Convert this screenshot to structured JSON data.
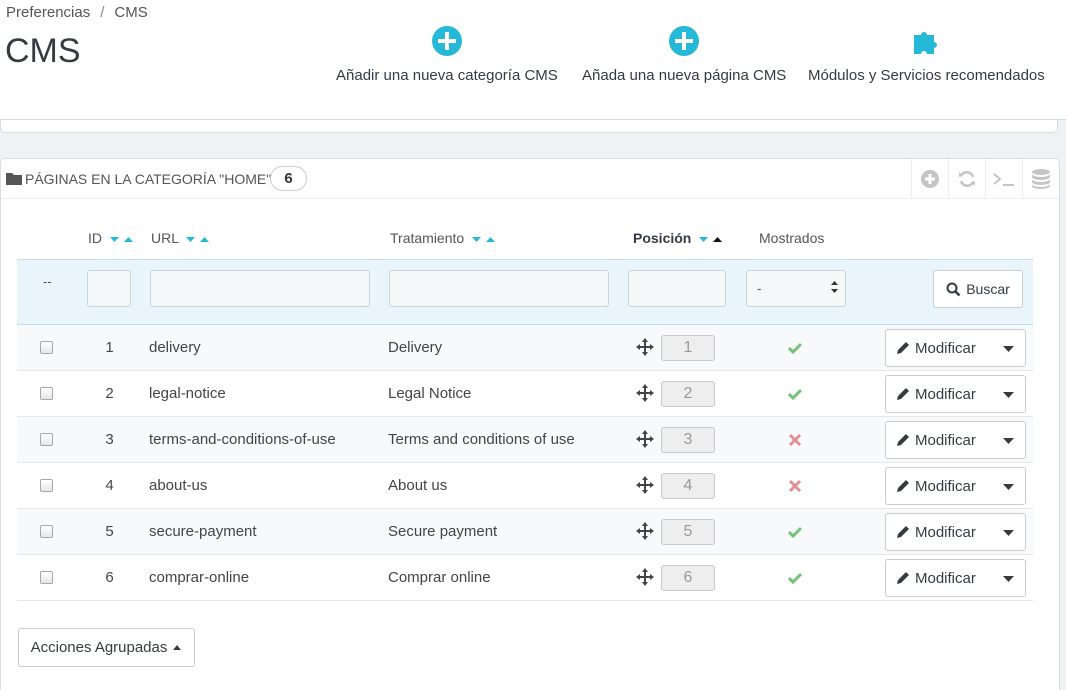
{
  "breadcrumb": {
    "parent": "Preferencias",
    "separator": "/",
    "current": "CMS"
  },
  "page_title": "CMS",
  "toolbar": {
    "add_category": "Añadir una nueva categoría CMS",
    "add_page": "Añada una nueva página CMS",
    "modules": "Módulos y Servicios recomendados"
  },
  "panel": {
    "title": "PÁGINAS EN LA CATEGORÍA \"HOME\"",
    "count": "6"
  },
  "columns": {
    "id": "ID",
    "url": "URL",
    "title": "Tratamiento",
    "position": "Posición",
    "shown": "Mostrados"
  },
  "filter": {
    "dash": "--",
    "shown_value": "-",
    "search_label": "Buscar"
  },
  "rows": [
    {
      "id": "1",
      "url": "delivery",
      "title": "Delivery",
      "position": "1",
      "shown": true,
      "action": "Modificar"
    },
    {
      "id": "2",
      "url": "legal-notice",
      "title": "Legal Notice",
      "position": "2",
      "shown": true,
      "action": "Modificar"
    },
    {
      "id": "3",
      "url": "terms-and-conditions-of-use",
      "title": "Terms and conditions of use",
      "position": "3",
      "shown": false,
      "action": "Modificar"
    },
    {
      "id": "4",
      "url": "about-us",
      "title": "About us",
      "position": "4",
      "shown": false,
      "action": "Modificar"
    },
    {
      "id": "5",
      "url": "secure-payment",
      "title": "Secure payment",
      "position": "5",
      "shown": true,
      "action": "Modificar"
    },
    {
      "id": "6",
      "url": "comprar-online",
      "title": "Comprar online",
      "position": "6",
      "shown": true,
      "action": "Modificar"
    }
  ],
  "bulk_actions": "Acciones Agrupadas",
  "colors": {
    "accent": "#25b9d7",
    "enabled": "#72c279",
    "disabled": "#e08f95"
  }
}
